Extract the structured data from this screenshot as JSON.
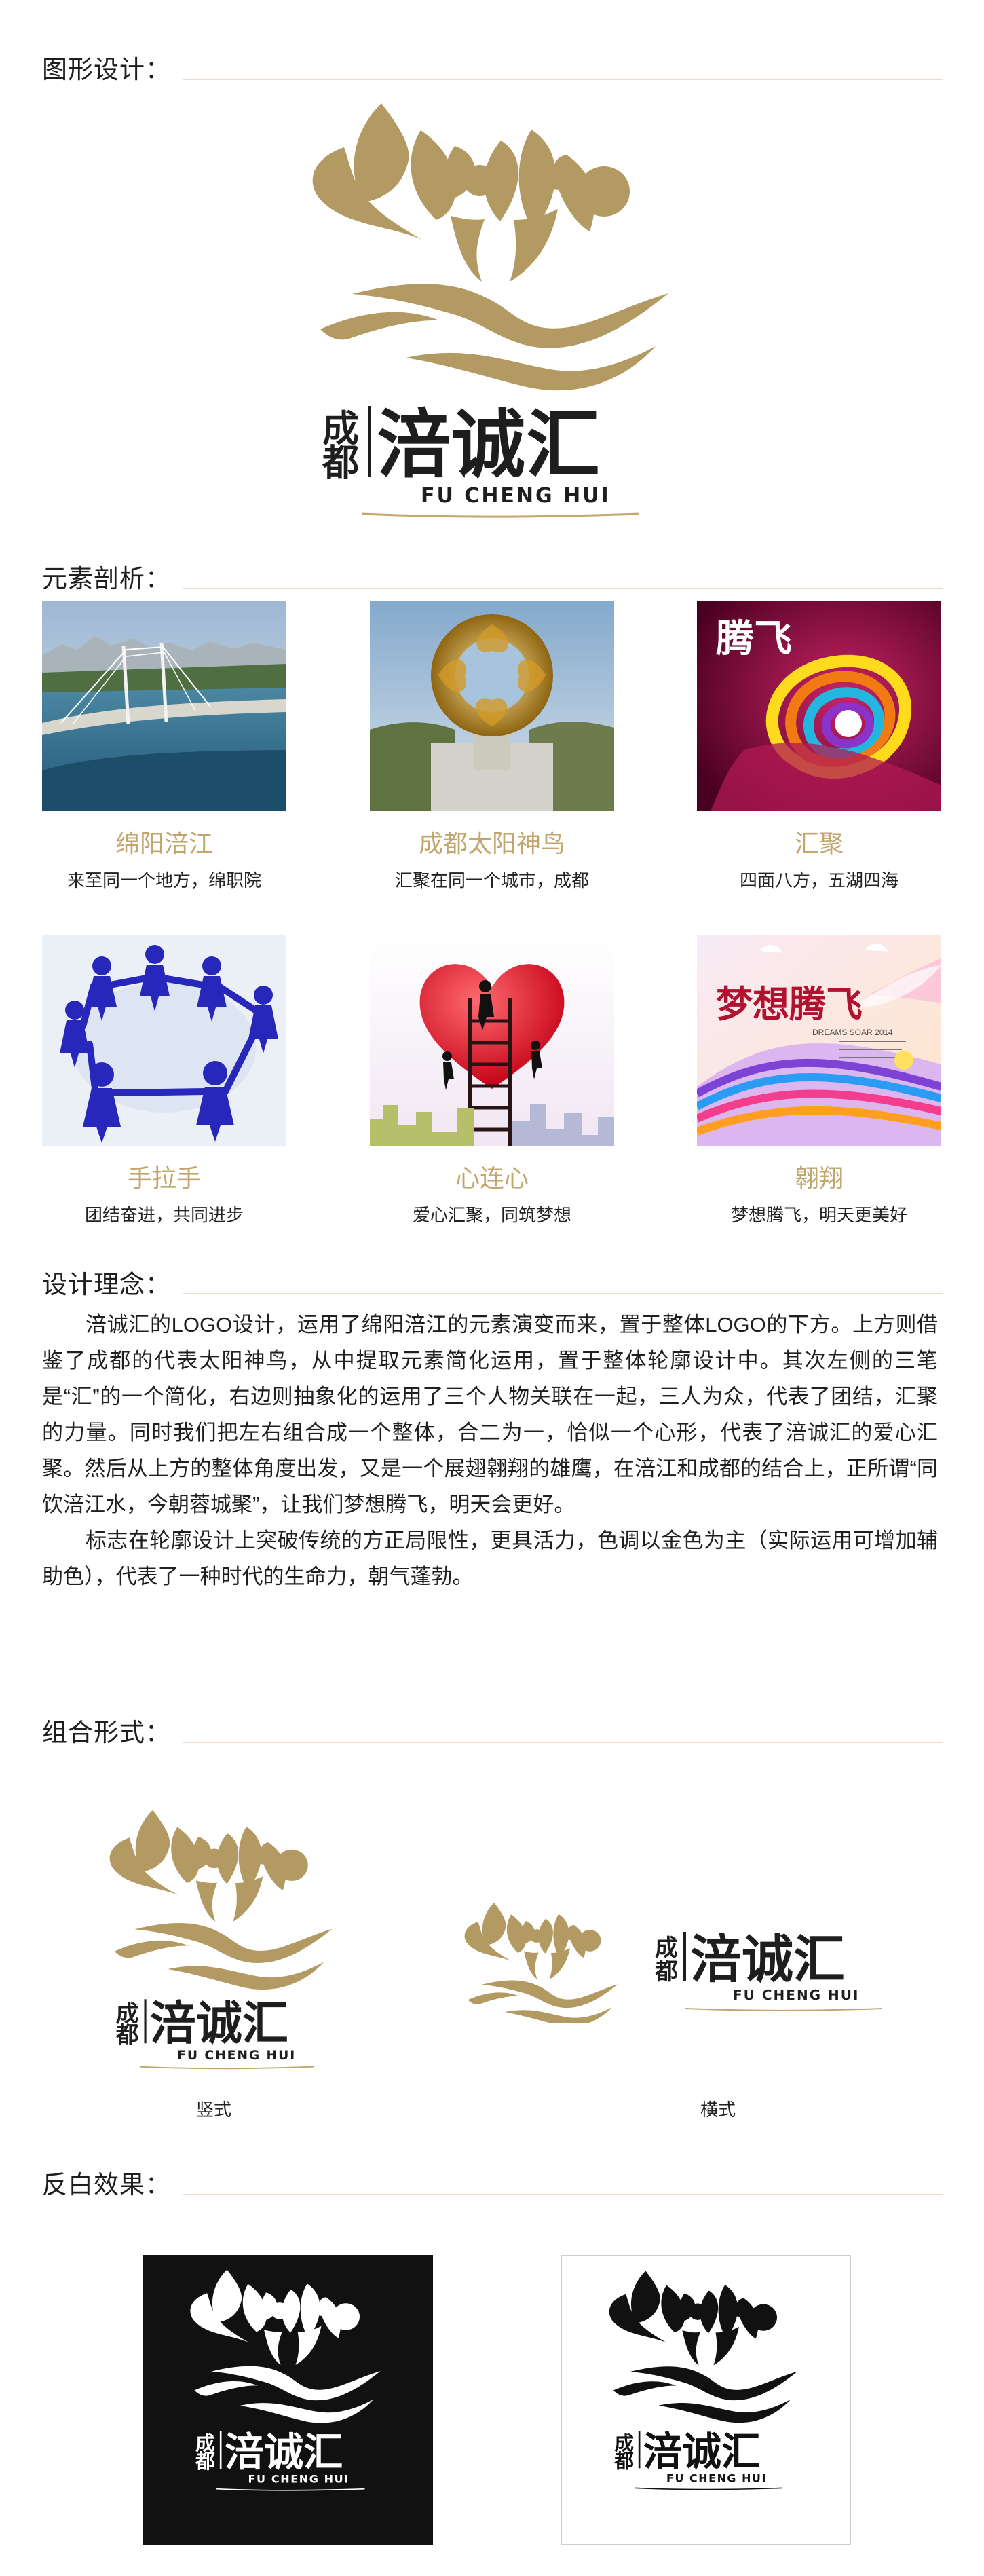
{
  "colors": {
    "gold": "#b39a63",
    "dark_text": "#1e1e1e",
    "rule": "#e7dcc6",
    "title_gold": "#c1a66e",
    "inverse_black": "#111111",
    "white": "#ffffff"
  },
  "sections": {
    "graphic_design": "图形设计：",
    "element_analysis": "元素剖析：",
    "design_concept": "设计理念：",
    "combination": "组合形式：",
    "inverse": "反白效果："
  },
  "logo": {
    "small_chars": "成都",
    "main_text": "涪诚汇",
    "english": "FU CHENG HUI"
  },
  "elements": [
    {
      "title": "绵阳涪江",
      "desc": "来至同一个地方，绵职院",
      "image": "bridge-river-photo"
    },
    {
      "title": "成都太阳神鸟",
      "desc": "汇聚在同一个城市，成都",
      "image": "sunbird-sculpture-photo"
    },
    {
      "title": "汇聚",
      "desc": "四面八方，五湖四海",
      "image": "colorful-swirl-photo"
    },
    {
      "title": "手拉手",
      "desc": "团结奋进，共同进步",
      "image": "people-circle-photo"
    },
    {
      "title": "心连心",
      "desc": "爱心汇聚，同筑梦想",
      "image": "heart-ladder-photo"
    },
    {
      "title": "翱翔",
      "desc": "梦想腾飞，明天更美好",
      "image": "wings-dream-photo"
    }
  ],
  "concept": {
    "paragraphs": [
      "涪诚汇的LOGO设计，运用了绵阳涪江的元素演变而来，置于整体LOGO的下方。上方则借鉴了成都的代表太阳神鸟，从中提取元素简化运用，置于整体轮廓设计中。其次左侧的三笔是“汇”的一个简化，右边则抽象化的运用了三个人物关联在一起，三人为众，代表了团结，汇聚的力量。同时我们把左右组合成一个整体，合二为一，恰似一个心形，代表了涪诚汇的爱心汇聚。然后从上方的整体角度出发，又是一个展翅翱翔的雄鹰，在涪江和成都的结合上，正所谓“同饮涪江水，今朝蓉城聚”，让我们梦想腾飞，明天会更好。",
      "标志在轮廓设计上突破传统的方正局限性，更具活力，色调以金色为主（实际运用可增加辅助色），代表了一种时代的生命力，朝气蓬勃。"
    ]
  },
  "combination": {
    "vertical_label": "竖式",
    "horizontal_label": "横式"
  },
  "photo_texts": {
    "soar_title": "腾飞",
    "dream_title": "梦想腾飞",
    "dream_subtitle": "DREAMS SOAR 2014"
  }
}
